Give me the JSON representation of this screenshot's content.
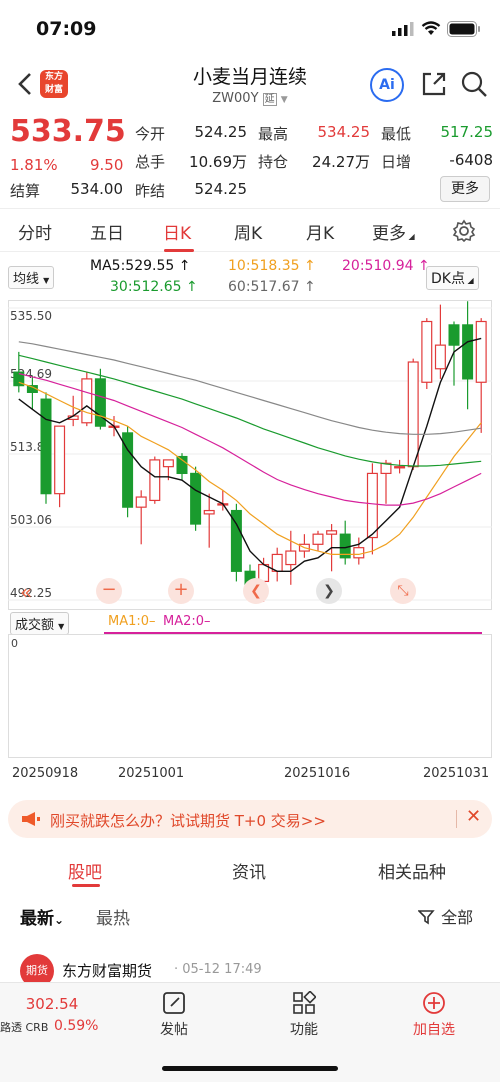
{
  "status": {
    "time": "07:09"
  },
  "nav": {
    "logo_line1": "东方",
    "logo_line2": "财富",
    "title": "小麦当月连续",
    "code": "ZW00Y",
    "code_tag": "延",
    "ai_label": "Ai"
  },
  "quote": {
    "price": "533.75",
    "change_pct": "1.81%",
    "change": "9.50",
    "open_label": "今开",
    "open": "524.25",
    "high_label": "最高",
    "high": "534.25",
    "low_label": "最低",
    "low": "517.25",
    "volume_label": "总手",
    "volume": "10.69万",
    "oi_label": "持仓",
    "oi": "24.27万",
    "oi_inc_label": "日增",
    "oi_inc": "-6408",
    "settle_label": "结算",
    "settle": "534.00",
    "prev_settle_label": "昨结",
    "prev_settle": "524.25",
    "more": "更多"
  },
  "tabs": [
    "分时",
    "五日",
    "日K",
    "周K",
    "月K",
    "更多"
  ],
  "ma": {
    "selector": "均线",
    "ma5": "MA5:529.55 ↑",
    "ma10": "10:518.35 ↑",
    "ma20": "20:510.94 ↑",
    "ma30": "30:512.65 ↑",
    "ma60": "60:517.67 ↑",
    "dk": "DK点",
    "colors": {
      "ma5": "#111111",
      "ma10": "#f0a020",
      "ma20": "#d6219b",
      "ma30": "#1a9b2e",
      "ma60": "#888888"
    }
  },
  "chart_data": {
    "type": "candlestick",
    "y_ticks": [
      "535.50",
      "524.69",
      "513.88",
      "503.06",
      "492.25"
    ],
    "ylim": [
      492.25,
      535.5
    ],
    "x_ticks": [
      "20250918",
      "20251001",
      "20251016",
      "20251031"
    ],
    "candles": [
      {
        "o": 526.0,
        "h": 529.0,
        "l": 523.0,
        "c": 524.0
      },
      {
        "o": 524.0,
        "h": 525.5,
        "l": 520.5,
        "c": 523.0
      },
      {
        "o": 522.0,
        "h": 523.0,
        "l": 506.5,
        "c": 508.0
      },
      {
        "o": 508.0,
        "h": 518.0,
        "l": 506.0,
        "c": 518.0
      },
      {
        "o": 519.0,
        "h": 522.5,
        "l": 518.0,
        "c": 519.5
      },
      {
        "o": 518.5,
        "h": 526.0,
        "l": 518.0,
        "c": 525.0
      },
      {
        "o": 525.0,
        "h": 526.5,
        "l": 517.5,
        "c": 518.0
      },
      {
        "o": 518.0,
        "h": 519.5,
        "l": 516.5,
        "c": 518.0
      },
      {
        "o": 517.0,
        "h": 518.0,
        "l": 504.5,
        "c": 506.0
      },
      {
        "o": 506.0,
        "h": 508.5,
        "l": 500.5,
        "c": 507.5
      },
      {
        "o": 507.0,
        "h": 513.5,
        "l": 506.5,
        "c": 513.0
      },
      {
        "o": 512.0,
        "h": 513.0,
        "l": 510.0,
        "c": 513.0
      },
      {
        "o": 513.5,
        "h": 514.0,
        "l": 510.0,
        "c": 511.0
      },
      {
        "o": 511.0,
        "h": 512.0,
        "l": 502.5,
        "c": 503.5
      },
      {
        "o": 505.0,
        "h": 508.0,
        "l": 500.0,
        "c": 505.5
      },
      {
        "o": 506.5,
        "h": 508.5,
        "l": 505.5,
        "c": 506.5
      },
      {
        "o": 505.5,
        "h": 506.5,
        "l": 495.0,
        "c": 496.5
      },
      {
        "o": 496.5,
        "h": 497.5,
        "l": 493.5,
        "c": 494.0
      },
      {
        "o": 495.0,
        "h": 498.5,
        "l": 492.0,
        "c": 497.5
      },
      {
        "o": 496.5,
        "h": 500.0,
        "l": 495.0,
        "c": 499.0
      },
      {
        "o": 497.5,
        "h": 502.5,
        "l": 494.5,
        "c": 499.5
      },
      {
        "o": 499.5,
        "h": 502.0,
        "l": 498.5,
        "c": 500.5
      },
      {
        "o": 500.5,
        "h": 502.5,
        "l": 499.5,
        "c": 502.0
      },
      {
        "o": 502.0,
        "h": 503.5,
        "l": 496.5,
        "c": 502.5
      },
      {
        "o": 502.0,
        "h": 504.0,
        "l": 497.5,
        "c": 498.5
      },
      {
        "o": 498.5,
        "h": 501.5,
        "l": 497.5,
        "c": 500.0
      },
      {
        "o": 501.5,
        "h": 512.5,
        "l": 499.0,
        "c": 511.0
      },
      {
        "o": 511.0,
        "h": 513.0,
        "l": 506.5,
        "c": 512.5
      },
      {
        "o": 512.0,
        "h": 513.0,
        "l": 511.0,
        "c": 512.0
      },
      {
        "o": 512.0,
        "h": 528.0,
        "l": 511.5,
        "c": 527.5
      },
      {
        "o": 524.5,
        "h": 534.0,
        "l": 523.5,
        "c": 533.5
      },
      {
        "o": 526.5,
        "h": 536.0,
        "l": 525.0,
        "c": 530.0
      },
      {
        "o": 533.0,
        "h": 533.5,
        "l": 524.0,
        "c": 530.0
      },
      {
        "o": 533.0,
        "h": 536.5,
        "l": 520.5,
        "c": 525.0
      },
      {
        "o": 524.5,
        "h": 534.0,
        "l": 517.0,
        "c": 533.5
      }
    ],
    "ma_lines": {
      "ma5": [
        522.0,
        520.5,
        519.0,
        518.5,
        519.5,
        521.0,
        519.5,
        518.0,
        514.5,
        512.0,
        510.5,
        510.5,
        510.0,
        508.5,
        507.5,
        506.5,
        503.5,
        499.5,
        497.5,
        496.5,
        496.5,
        498.0,
        498.5,
        500.0,
        500.0,
        500.5,
        502.0,
        504.0,
        506.0,
        512.0,
        518.0,
        524.5,
        529.0,
        530.5,
        531.0
      ],
      "ma10": [
        524.5,
        523.8,
        522.8,
        521.8,
        520.8,
        520.0,
        519.5,
        518.8,
        518.0,
        516.5,
        515.5,
        514.5,
        513.0,
        511.5,
        509.8,
        508.5,
        507.0,
        505.0,
        503.5,
        502.0,
        501.0,
        500.0,
        499.5,
        499.0,
        499.0,
        499.0,
        499.5,
        500.5,
        502.0,
        504.5,
        507.5,
        510.5,
        513.5,
        516.0,
        518.5
      ],
      "ma20": [
        525.8,
        525.3,
        524.8,
        524.2,
        523.6,
        523.0,
        522.4,
        521.8,
        521.0,
        520.2,
        519.4,
        518.6,
        517.8,
        516.8,
        515.8,
        514.8,
        513.6,
        512.4,
        511.2,
        510.1,
        509.3,
        508.6,
        508.0,
        507.5,
        507.0,
        506.7,
        506.5,
        506.3,
        506.3,
        506.6,
        507.2,
        508.0,
        509.0,
        510.0,
        511.0
      ],
      "ma30": [
        528.5,
        528.0,
        527.5,
        527.0,
        526.5,
        526.0,
        525.5,
        525.0,
        524.4,
        523.8,
        523.2,
        522.6,
        522.0,
        521.3,
        520.6,
        519.9,
        519.2,
        518.4,
        517.6,
        516.9,
        516.2,
        515.5,
        514.8,
        514.2,
        513.6,
        513.1,
        512.7,
        512.4,
        512.2,
        512.1,
        512.1,
        512.2,
        512.4,
        512.6,
        512.8
      ],
      "ma60": [
        530.5,
        530.2,
        529.8,
        529.4,
        529.0,
        528.6,
        528.2,
        527.8,
        527.3,
        526.8,
        526.3,
        525.8,
        525.3,
        524.8,
        524.2,
        523.6,
        523.0,
        522.4,
        521.8,
        521.2,
        520.6,
        520.0,
        519.4,
        518.8,
        518.3,
        517.8,
        517.4,
        517.1,
        516.9,
        516.8,
        516.8,
        516.9,
        517.1,
        517.4,
        517.7
      ]
    },
    "volume_panel": {
      "selector": "成交额",
      "ma1": "MA1:0–",
      "ma2": "MA2:0–",
      "y_tick": "0"
    }
  },
  "banner": {
    "text": "刚买就跌怎么办？试试期货 T+0 交易>>"
  },
  "bottom_tabs": [
    "股吧",
    "资讯",
    "相关品种"
  ],
  "sort": {
    "newest": "最新",
    "hottest": "最热",
    "filter": "全部"
  },
  "post": {
    "author": "东方财富期货",
    "time": "· 05-12 17:49",
    "avatar_text": "期货"
  },
  "bottom_bar": {
    "index_value": "302.54",
    "index_name": "路透 CRB",
    "index_pct": "0.59%",
    "post": "发帖",
    "func": "功能",
    "watch": "加自选"
  }
}
